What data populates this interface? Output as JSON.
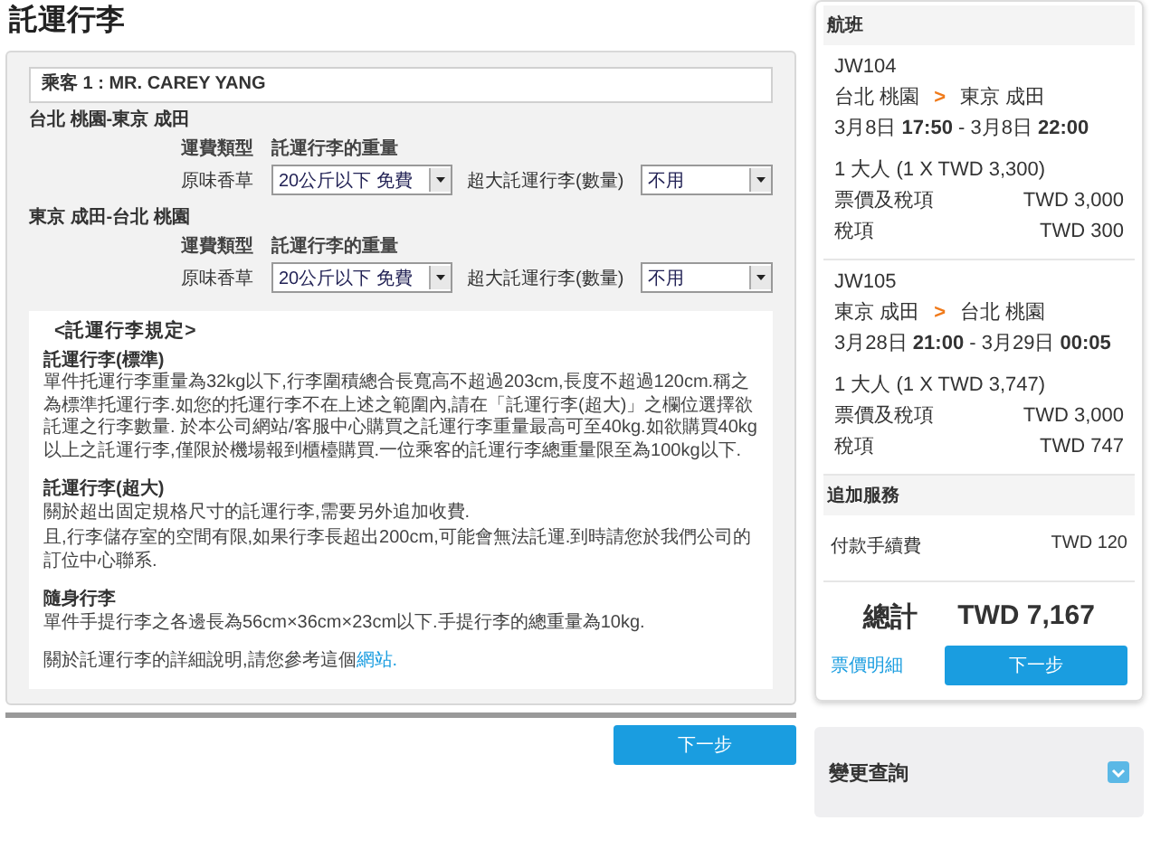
{
  "title": "託運行李",
  "passenger": "乘客 1 : MR. CAREY YANG",
  "segments": [
    {
      "route": "台北 桃園-東京 成田",
      "fare_type_label": "運費類型",
      "fare_type": "原味香草",
      "weight_label": "託運行李的重量",
      "weight_value": "20公斤以下 免費",
      "oversize_label": "超大託運行李(數量)",
      "oversize_value": "不用"
    },
    {
      "route": "東京 成田-台北 桃園",
      "fare_type_label": "運費類型",
      "fare_type": "原味香草",
      "weight_label": "託運行李的重量",
      "weight_value": "20公斤以下 免費",
      "oversize_label": "超大託運行李(數量)",
      "oversize_value": "不用"
    }
  ],
  "rules": {
    "heading": "<託運行李規定>",
    "sections": [
      {
        "title": "託運行李(標準)",
        "paragraphs": [
          "單件托運行李重量為32kg以下,行李圍積總合長寬高不超過203cm,長度不超過120cm.稱之為標準托運行李.如您的托運行李不在上述之範圍內,請在「託運行李(超大)」之欄位選擇欲託運之行李數量. 於本公司網站/客服中心購買之託運行李重量最高可至40kg.如欲購買40kg以上之託運行李,僅限於機場報到櫃檯購買.一位乘客的託運行李總重量限至為100kg以下."
        ]
      },
      {
        "title": "託運行李(超大)",
        "paragraphs": [
          "關於超出固定規格尺寸的託運行李,需要另外追加收費.",
          "且,行李儲存室的空間有限,如果行李長超出200cm,可能會無法託運.到時請您於我們公司的訂位中心聯系."
        ]
      },
      {
        "title": "隨身行李",
        "paragraphs": [
          "單件手提行李之各邊長為56cm×36cm×23cm以下.手提行李的總重量為10kg."
        ]
      }
    ],
    "footer": "關於託運行李的詳細說明,請您參考這個",
    "footer_link": "網站."
  },
  "next_button": "下一步",
  "sidebar": {
    "header": "航班",
    "flights": [
      {
        "number": "JW104",
        "from": "台北 桃園",
        "arrow": ">",
        "to": "東京 成田",
        "times": "3月8日 **17:50** - 3月8日 **22:00**",
        "passengers": "1 大人 (1 X TWD 3,300)",
        "rows": [
          {
            "label": "票價及稅項",
            "value": "TWD 3,000"
          },
          {
            "label": "稅項",
            "value": "TWD 300"
          }
        ]
      },
      {
        "number": "JW105",
        "from": "東京 成田",
        "arrow": ">",
        "to": "台北 桃園",
        "times": "3月28日 **21:00** - 3月29日 **00:05**",
        "passengers": "1 大人 (1 X TWD 3,747)",
        "rows": [
          {
            "label": "票價及稅項",
            "value": "TWD 3,000"
          },
          {
            "label": "稅項",
            "value": "TWD 747"
          }
        ]
      }
    ],
    "extras_header": "追加服務",
    "extras": [
      {
        "label": "付款手續費",
        "value": "TWD 120"
      }
    ],
    "total_label": "總計",
    "total_value": "TWD 7,167",
    "details_link": "票價明細",
    "next_button": "下一步"
  },
  "change_query": "變更查詢"
}
